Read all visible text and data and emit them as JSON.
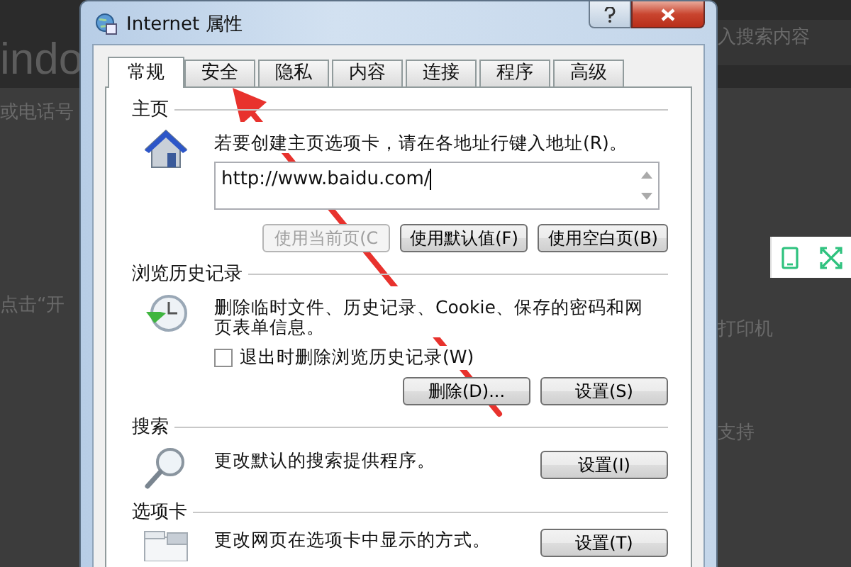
{
  "background": {
    "texts": [
      {
        "text": "indo",
        "kind": "large"
      },
      {
        "text": "或电话号",
        "kind": "left"
      },
      {
        "text": "点击“开",
        "kind": "left"
      },
      {
        "text": "入搜索内容",
        "kind": "right"
      },
      {
        "text": "打印机",
        "kind": "right"
      },
      {
        "text": "支持",
        "kind": "right"
      }
    ]
  },
  "window": {
    "title": "Internet 属性"
  },
  "tabs": [
    {
      "label": "常规",
      "selected": true
    },
    {
      "label": "安全",
      "selected": false
    },
    {
      "label": "隐私",
      "selected": false
    },
    {
      "label": "内容",
      "selected": false
    },
    {
      "label": "连接",
      "selected": false
    },
    {
      "label": "程序",
      "selected": false
    },
    {
      "label": "高级",
      "selected": false
    }
  ],
  "sections": [
    {
      "heading": "主页",
      "description": "若要创建主页选项卡，请在各地址行键入地址(R)。",
      "address": "http://www.baidu.com/",
      "buttons": [
        {
          "label": "使用当前页(C",
          "disabled": true
        },
        {
          "label": "使用默认值(F)",
          "disabled": false
        },
        {
          "label": "使用空白页(B)",
          "disabled": false
        }
      ]
    },
    {
      "heading": "浏览历史记录",
      "description": "删除临时文件、历史记录、Cookie、保存的密码和网页表单信息。",
      "checkbox": {
        "label": "退出时删除浏览历史记录(W)",
        "checked": false
      },
      "buttons": [
        {
          "label": "删除(D)...",
          "disabled": false
        },
        {
          "label": "设置(S)",
          "disabled": false
        }
      ]
    },
    {
      "heading": "搜索",
      "description": "更改默认的搜索提供程序。",
      "buttons": [
        {
          "label": "设置(I)",
          "disabled": false
        }
      ]
    },
    {
      "heading": "选项卡",
      "description": "更改网页在选项卡中显示的方式。",
      "buttons": [
        {
          "label": "设置(T)",
          "disabled": false
        }
      ]
    }
  ]
}
